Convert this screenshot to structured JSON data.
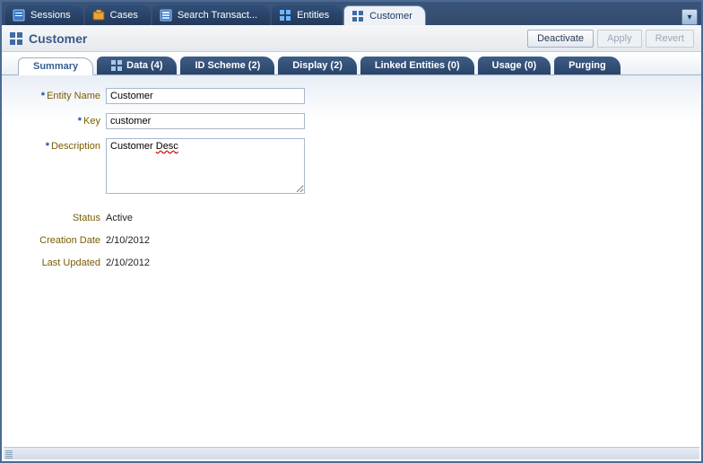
{
  "topTabs": [
    {
      "label": "Sessions",
      "iconName": "sessions-icon"
    },
    {
      "label": "Cases",
      "iconName": "cases-icon"
    },
    {
      "label": "Search Transact...",
      "iconName": "search-transactions-icon"
    },
    {
      "label": "Entities",
      "iconName": "entities-icon"
    },
    {
      "label": "Customer",
      "iconName": "customer-icon",
      "active": true
    }
  ],
  "page": {
    "title": "Customer",
    "actions": {
      "deactivate": "Deactivate",
      "apply": "Apply",
      "revert": "Revert"
    }
  },
  "subTabs": [
    {
      "label": "Summary",
      "active": true
    },
    {
      "label": "Data (4)"
    },
    {
      "label": "ID Scheme (2)"
    },
    {
      "label": "Display (2)"
    },
    {
      "label": "Linked Entities (0)"
    },
    {
      "label": "Usage (0)"
    },
    {
      "label": "Purging"
    }
  ],
  "form": {
    "entityName": {
      "label": "Entity Name",
      "value": "Customer",
      "required": true
    },
    "key": {
      "label": "Key",
      "value": "customer",
      "required": true
    },
    "description": {
      "label": "Description",
      "value_pre": "Customer ",
      "value_err": "Desc",
      "required": true
    },
    "status": {
      "label": "Status",
      "value": "Active"
    },
    "creationDate": {
      "label": "Creation Date",
      "value": "2/10/2012"
    },
    "lastUpdated": {
      "label": "Last Updated",
      "value": "2/10/2012"
    }
  },
  "requiredMark": "*"
}
